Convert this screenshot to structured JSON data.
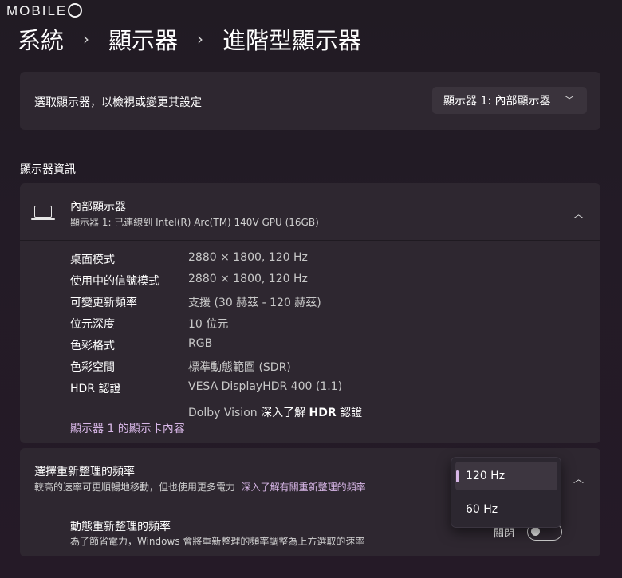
{
  "watermark": {
    "text": "MOBILE"
  },
  "breadcrumb": [
    "系統",
    "顯示器",
    "進階型顯示器"
  ],
  "breadcrumb_sep": "›",
  "select_display": {
    "label": "選取顯示器，以檢視或變更其設定",
    "value": "顯示器 1: 內部顯示器"
  },
  "section_title": "顯示器資訊",
  "display_info": {
    "title": "內部顯示器",
    "subtitle": "顯示器 1: 已連線到 Intel(R) Arc(TM) 140V GPU (16GB)",
    "rows": [
      {
        "key": "桌面模式",
        "value": "2880 × 1800, 120 Hz"
      },
      {
        "key": "使用中的信號模式",
        "value": "2880 × 1800, 120 Hz"
      },
      {
        "key": "可變更新頻率",
        "value": "支援 (30 赫茲 - 120 赫茲)"
      },
      {
        "key": "位元深度",
        "value": "10 位元"
      },
      {
        "key": "色彩格式",
        "value": "RGB"
      },
      {
        "key": "色彩空間",
        "value": "標準動態範圍 (SDR)"
      },
      {
        "key": "HDR 認證",
        "value": "VESA DisplayHDR 400 (1.1)"
      }
    ],
    "hdr_line2_prefix": "Dolby Vision",
    "hdr_line2_link_prefix": "深入了解",
    "hdr_line2_link_bold": "HDR",
    "hdr_line2_link_suffix": "認證",
    "gpu_link": "顯示器 1 的顯示卡內容"
  },
  "refresh_rate": {
    "title": "選擇重新整理的頻率",
    "subtitle": "較高的速率可更順暢地移動，但也使用更多電力",
    "learn_more": "深入了解有關重新整理的頻率",
    "options": [
      "120 Hz",
      "60 Hz"
    ],
    "selected": "120 Hz"
  },
  "dynamic_refresh": {
    "title": "動態重新整理的頻率",
    "subtitle": "為了節省電力，Windows 會將重新整理的頻率調整為上方選取的速率",
    "toggle_label": "關閉",
    "enabled": false
  },
  "colors": {
    "accent": "#d7b6e6",
    "card": "#2e2730",
    "background": "#231b26"
  },
  "icons": [
    "chevron-down-icon",
    "chevron-up-icon",
    "laptop-icon"
  ]
}
